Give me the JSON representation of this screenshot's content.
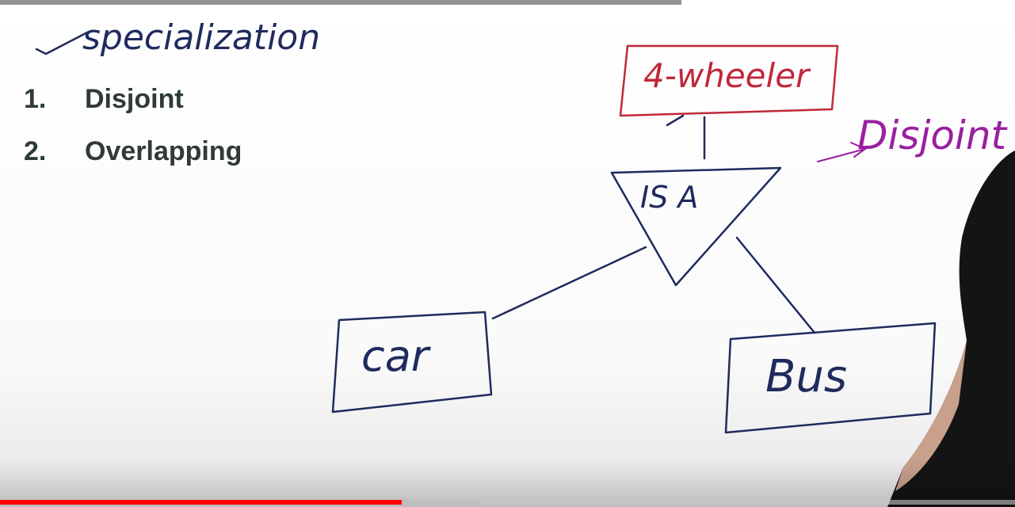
{
  "slide": {
    "items": [
      {
        "number": "1.",
        "label": "Disjoint"
      },
      {
        "number": "2.",
        "label": "Overlapping"
      }
    ]
  },
  "whiteboard": {
    "heading": "specialization",
    "superclass": "4-wheeler",
    "relation": "IS A",
    "constraint": "Disjoint",
    "subclass_left": "car",
    "subclass_right": "Bus",
    "colors": {
      "ink": "#1f2b5e",
      "superclass_ink": "#c0283a",
      "constraint_ink": "#9a1fa0"
    }
  },
  "player": {
    "progress_played": 0.396,
    "progress_buffered": 0.473,
    "colors": {
      "played": "#ff0000",
      "buffered": "#bebebe"
    }
  }
}
